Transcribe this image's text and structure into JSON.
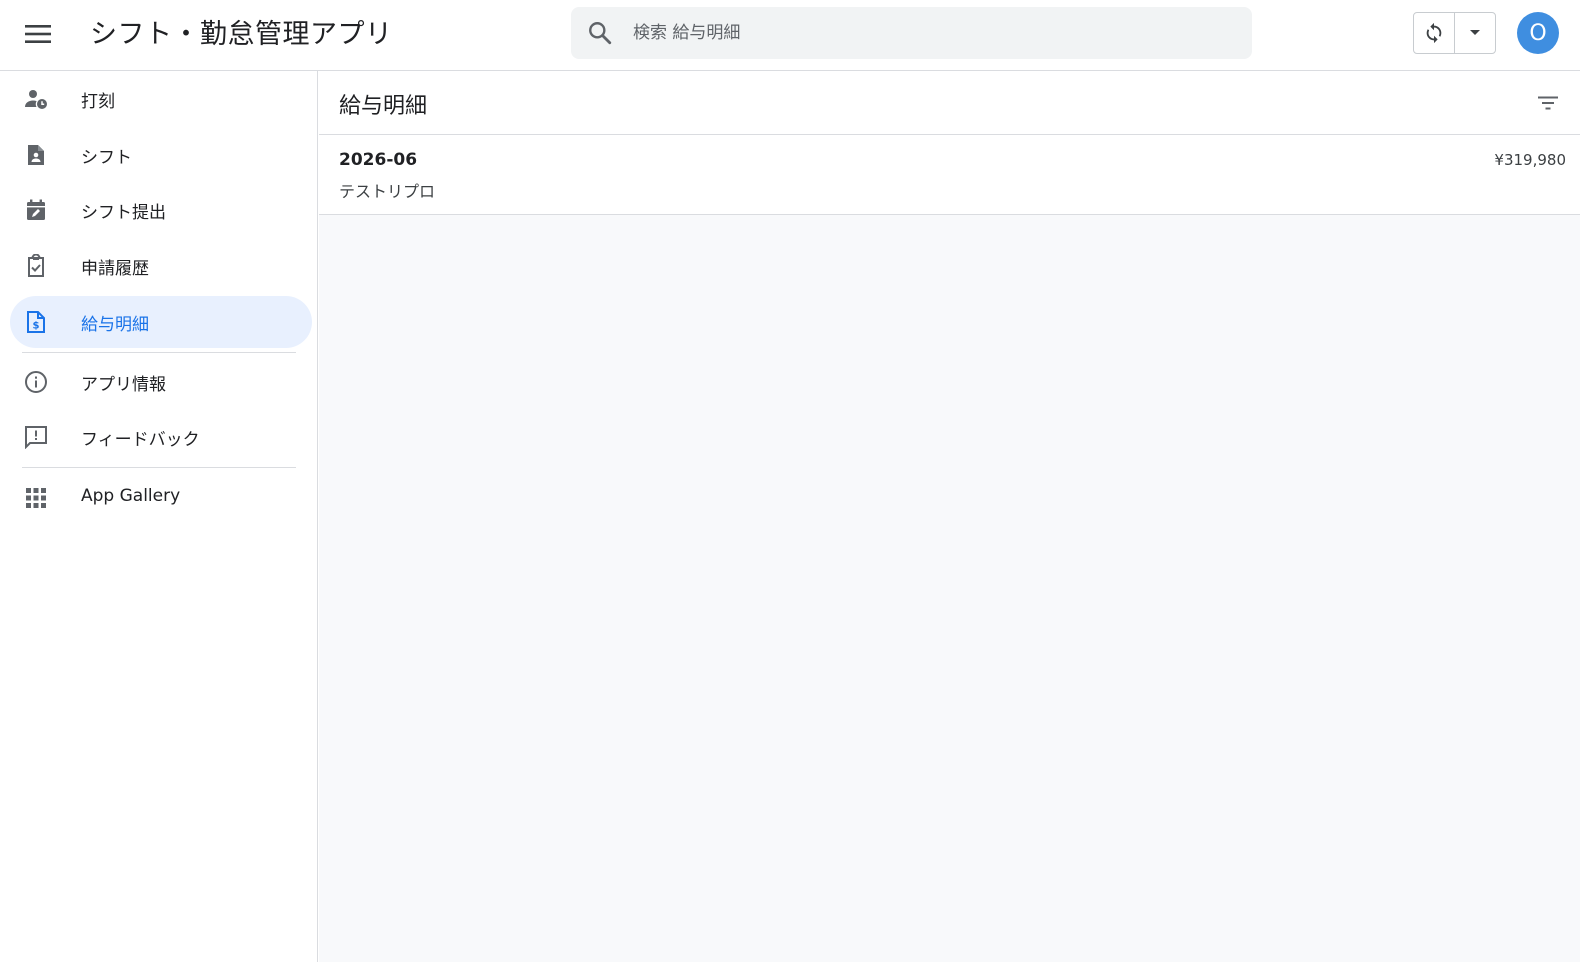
{
  "header": {
    "app_title": "シフト・勤怠管理アプリ",
    "search_placeholder": "検索 給与明細",
    "avatar_initial": "O"
  },
  "sidebar": {
    "items": [
      {
        "label": "打刻",
        "icon": "person-clock-icon"
      },
      {
        "label": "シフト",
        "icon": "badge-document-icon"
      },
      {
        "label": "シフト提出",
        "icon": "calendar-edit-icon"
      },
      {
        "label": "申請履歴",
        "icon": "clipboard-check-icon"
      },
      {
        "label": "給与明細",
        "icon": "dollar-document-icon",
        "active": true
      },
      {
        "label": "アプリ情報",
        "icon": "info-icon"
      },
      {
        "label": "フィードバック",
        "icon": "feedback-icon"
      },
      {
        "label": "App Gallery",
        "icon": "apps-grid-icon"
      }
    ]
  },
  "main": {
    "title": "給与明細",
    "records": [
      {
        "period": "2026-06",
        "name": "テストリプロ",
        "amount": "¥319,980"
      }
    ]
  },
  "colors": {
    "accent": "#1a73e8",
    "active_bg": "#e8f0fe",
    "avatar": "#3f8ee0",
    "icon": "#5f6368"
  }
}
